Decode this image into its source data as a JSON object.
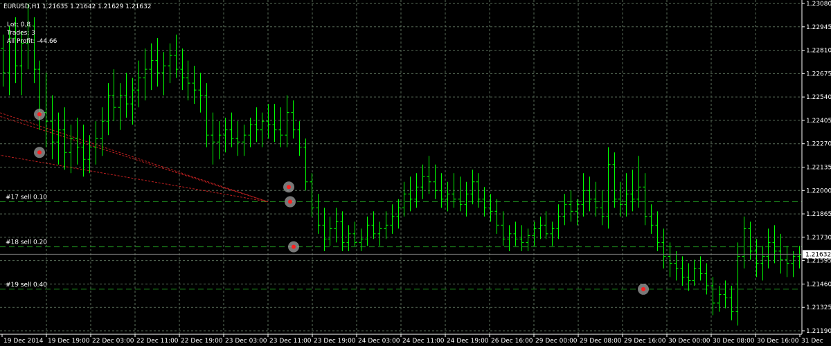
{
  "header": {
    "symbol": "EURUSD,H1",
    "ohlc": "1.21635 1.21642 1.21629 1.21632"
  },
  "info": {
    "lot": "Lot: 0.8",
    "trades": "Trades: 3",
    "profit": "All Profit: -44.66"
  },
  "colors": {
    "background": "#000000",
    "grid": "#5a6e5a",
    "bars": "#00ff00",
    "axis_text": "#ffffff",
    "order_line": "#1e8a1e",
    "trend_line": "#c02020",
    "marker_ring": "#a0a0a0",
    "marker_center": "#ff2020",
    "current_price_box": "#ffffff"
  },
  "chart_data": {
    "type": "ohlc",
    "symbol": "EURUSD",
    "timeframe": "H1",
    "y_ticks": [
      1.2119,
      1.21325,
      1.2146,
      1.21595,
      1.2173,
      1.21865,
      1.22,
      1.22135,
      1.2227,
      1.22405,
      1.2254,
      1.22675,
      1.2281,
      1.22945,
      1.2308
    ],
    "ylim": [
      1.2117,
      1.231
    ],
    "current_price": 1.21632,
    "x_ticks": [
      "19 Dec 2014",
      "19 Dec 19:00",
      "22 Dec 03:00",
      "22 Dec 11:00",
      "22 Dec 19:00",
      "23 Dec 03:00",
      "23 Dec 11:00",
      "23 Dec 19:00",
      "24 Dec 03:00",
      "24 Dec 11:00",
      "24 Dec 19:00",
      "26 Dec 16:00",
      "29 Dec 00:00",
      "29 Dec 08:00",
      "29 Dec 16:00",
      "30 Dec 00:00",
      "30 Dec 08:00",
      "30 Dec 16:00",
      "31 Dec"
    ],
    "order_levels": [
      {
        "label": "#17 sell 0.10",
        "price": 1.21935
      },
      {
        "label": "#18 sell 0.20",
        "price": 1.21675
      },
      {
        "label": "#19 sell 0.40",
        "price": 1.2143
      }
    ],
    "trend_lines": [
      {
        "from": [
          "19 Dec 2014",
          1.2247
        ],
        "to": [
          "23 Dec 11:00",
          1.21935
        ]
      },
      {
        "from": [
          "19 Dec 2014",
          1.2247
        ],
        "to": [
          "23 Dec 11:00",
          1.21935
        ]
      },
      {
        "from": [
          "19 Dec 2014",
          1.2224
        ],
        "to": [
          "23 Dec 11:00",
          1.21935
        ]
      }
    ],
    "trade_markers": [
      {
        "time": "19 Dec 2014",
        "price": 1.2244
      },
      {
        "time": "19 Dec 2014",
        "price": 1.2222
      },
      {
        "time": "23 Dec 11:00",
        "price": 1.2202
      },
      {
        "time": "23 Dec 11:00",
        "price": 1.21935
      },
      {
        "time": "23 Dec 11:00",
        "price": 1.21675
      },
      {
        "time": "29 Dec 16:00",
        "price": 1.2143
      }
    ],
    "bars": [
      [
        1.2282,
        1.229,
        1.226,
        1.2268
      ],
      [
        1.2268,
        1.2295,
        1.2255,
        1.2288
      ],
      [
        1.2288,
        1.23,
        1.2262,
        1.2272
      ],
      [
        1.2272,
        1.2292,
        1.2255,
        1.2285
      ],
      [
        1.2285,
        1.2308,
        1.227,
        1.2295
      ],
      [
        1.2295,
        1.23,
        1.2262,
        1.227
      ],
      [
        1.227,
        1.2275,
        1.2235,
        1.2245
      ],
      [
        1.2245,
        1.2268,
        1.2225,
        1.224
      ],
      [
        1.224,
        1.2255,
        1.2218,
        1.2228
      ],
      [
        1.2228,
        1.2245,
        1.2215,
        1.2235
      ],
      [
        1.2235,
        1.2248,
        1.2212,
        1.2222
      ],
      [
        1.2222,
        1.2238,
        1.221,
        1.223
      ],
      [
        1.223,
        1.2242,
        1.2215,
        1.2225
      ],
      [
        1.2225,
        1.2238,
        1.2208,
        1.2218
      ],
      [
        1.2218,
        1.2232,
        1.221,
        1.2225
      ],
      [
        1.2225,
        1.224,
        1.2215,
        1.223
      ],
      [
        1.223,
        1.2248,
        1.222,
        1.224
      ],
      [
        1.224,
        1.2262,
        1.2232,
        1.2255
      ],
      [
        1.2255,
        1.227,
        1.224,
        1.2248
      ],
      [
        1.2248,
        1.2262,
        1.2235,
        1.2255
      ],
      [
        1.2255,
        1.2268,
        1.2242,
        1.225
      ],
      [
        1.225,
        1.2265,
        1.2238,
        1.2258
      ],
      [
        1.2258,
        1.2275,
        1.2248,
        1.2265
      ],
      [
        1.2265,
        1.2282,
        1.2252,
        1.227
      ],
      [
        1.227,
        1.2285,
        1.2258,
        1.2275
      ],
      [
        1.2275,
        1.2288,
        1.226,
        1.2268
      ],
      [
        1.2268,
        1.228,
        1.2255,
        1.2272
      ],
      [
        1.2272,
        1.2285,
        1.2262,
        1.2278
      ],
      [
        1.2278,
        1.229,
        1.2265,
        1.227
      ],
      [
        1.227,
        1.2282,
        1.2258,
        1.2265
      ],
      [
        1.2265,
        1.2275,
        1.2252,
        1.2262
      ],
      [
        1.2262,
        1.2272,
        1.225,
        1.2258
      ],
      [
        1.2258,
        1.2268,
        1.2245,
        1.2255
      ],
      [
        1.2255,
        1.2262,
        1.2225,
        1.2232
      ],
      [
        1.2232,
        1.2245,
        1.2215,
        1.2228
      ],
      [
        1.2228,
        1.224,
        1.2218,
        1.2232
      ],
      [
        1.2232,
        1.2242,
        1.2222,
        1.2235
      ],
      [
        1.2235,
        1.2245,
        1.2225,
        1.223
      ],
      [
        1.223,
        1.224,
        1.222,
        1.2228
      ],
      [
        1.2228,
        1.2238,
        1.222,
        1.2232
      ],
      [
        1.2232,
        1.2242,
        1.2225,
        1.2238
      ],
      [
        1.2238,
        1.2248,
        1.2228,
        1.2235
      ],
      [
        1.2235,
        1.2245,
        1.2225,
        1.224
      ],
      [
        1.224,
        1.225,
        1.223,
        1.2238
      ],
      [
        1.2238,
        1.225,
        1.2228,
        1.2235
      ],
      [
        1.2235,
        1.2248,
        1.2225,
        1.2232
      ],
      [
        1.2232,
        1.2255,
        1.2225,
        1.2245
      ],
      [
        1.2245,
        1.2252,
        1.223,
        1.2235
      ],
      [
        1.2235,
        1.224,
        1.222,
        1.2225
      ],
      [
        1.2225,
        1.223,
        1.22,
        1.2205
      ],
      [
        1.2205,
        1.221,
        1.2185,
        1.219
      ],
      [
        1.219,
        1.2198,
        1.2175,
        1.218
      ],
      [
        1.218,
        1.219,
        1.2165,
        1.2172
      ],
      [
        1.2172,
        1.2185,
        1.2168,
        1.2178
      ],
      [
        1.2178,
        1.219,
        1.217,
        1.2182
      ],
      [
        1.2182,
        1.2188,
        1.2165,
        1.217
      ],
      [
        1.217,
        1.218,
        1.2165,
        1.2175
      ],
      [
        1.2175,
        1.2182,
        1.2168,
        1.217
      ],
      [
        1.217,
        1.2178,
        1.2165,
        1.2172
      ],
      [
        1.2172,
        1.2185,
        1.2168,
        1.218
      ],
      [
        1.218,
        1.2188,
        1.2172,
        1.2175
      ],
      [
        1.2175,
        1.2182,
        1.2168,
        1.2178
      ],
      [
        1.2178,
        1.2188,
        1.2172,
        1.218
      ],
      [
        1.218,
        1.2192,
        1.2175,
        1.2185
      ],
      [
        1.2185,
        1.2195,
        1.2178,
        1.219
      ],
      [
        1.219,
        1.2205,
        1.2185,
        1.2198
      ],
      [
        1.2198,
        1.2208,
        1.2188,
        1.2195
      ],
      [
        1.2195,
        1.221,
        1.219,
        1.2202
      ],
      [
        1.2202,
        1.2215,
        1.2195,
        1.2208
      ],
      [
        1.2208,
        1.222,
        1.2198,
        1.2205
      ],
      [
        1.2205,
        1.2215,
        1.2195,
        1.22
      ],
      [
        1.22,
        1.221,
        1.219,
        1.2195
      ],
      [
        1.2195,
        1.2205,
        1.2188,
        1.2198
      ],
      [
        1.2198,
        1.221,
        1.219,
        1.2195
      ],
      [
        1.2195,
        1.2208,
        1.2188,
        1.2192
      ],
      [
        1.2192,
        1.2205,
        1.2185,
        1.2198
      ],
      [
        1.2198,
        1.2212,
        1.2192,
        1.2205
      ],
      [
        1.2205,
        1.221,
        1.219,
        1.2195
      ],
      [
        1.2195,
        1.2202,
        1.2185,
        1.219
      ],
      [
        1.219,
        1.2198,
        1.2182,
        1.2188
      ],
      [
        1.2188,
        1.2195,
        1.2175,
        1.218
      ],
      [
        1.218,
        1.2188,
        1.2168,
        1.2172
      ],
      [
        1.2172,
        1.218,
        1.2165,
        1.2175
      ],
      [
        1.2175,
        1.2182,
        1.2168,
        1.2172
      ],
      [
        1.2172,
        1.218,
        1.2165,
        1.217
      ],
      [
        1.217,
        1.2178,
        1.2165,
        1.2174
      ],
      [
        1.2174,
        1.2182,
        1.2168,
        1.2178
      ],
      [
        1.2178,
        1.2185,
        1.2172,
        1.218
      ],
      [
        1.218,
        1.2188,
        1.2172,
        1.2175
      ],
      [
        1.2175,
        1.2182,
        1.2168,
        1.2178
      ],
      [
        1.2178,
        1.2192,
        1.2172,
        1.2185
      ],
      [
        1.2185,
        1.2198,
        1.218,
        1.2192
      ],
      [
        1.2192,
        1.22,
        1.2182,
        1.2188
      ],
      [
        1.2188,
        1.2195,
        1.218,
        1.2192
      ],
      [
        1.2192,
        1.221,
        1.2185,
        1.22
      ],
      [
        1.22,
        1.2208,
        1.2188,
        1.2195
      ],
      [
        1.2195,
        1.2205,
        1.2185,
        1.219
      ],
      [
        1.219,
        1.22,
        1.218,
        1.2185
      ],
      [
        1.2185,
        1.2225,
        1.2178,
        1.2215
      ],
      [
        1.2215,
        1.2222,
        1.219,
        1.2195
      ],
      [
        1.2195,
        1.2205,
        1.2185,
        1.2192
      ],
      [
        1.2192,
        1.221,
        1.2185,
        1.2198
      ],
      [
        1.2198,
        1.2212,
        1.2188,
        1.2195
      ],
      [
        1.2195,
        1.222,
        1.219,
        1.2202
      ],
      [
        1.2202,
        1.221,
        1.218,
        1.2185
      ],
      [
        1.2185,
        1.2192,
        1.2175,
        1.218
      ],
      [
        1.218,
        1.2188,
        1.2165,
        1.217
      ],
      [
        1.217,
        1.2178,
        1.2155,
        1.2162
      ],
      [
        1.2162,
        1.217,
        1.215,
        1.2158
      ],
      [
        1.2158,
        1.2165,
        1.2148,
        1.2155
      ],
      [
        1.2155,
        1.2162,
        1.2145,
        1.215
      ],
      [
        1.215,
        1.2158,
        1.2142,
        1.2148
      ],
      [
        1.2148,
        1.216,
        1.2145,
        1.2155
      ],
      [
        1.2155,
        1.2162,
        1.2148,
        1.2152
      ],
      [
        1.2152,
        1.2158,
        1.214,
        1.2145
      ],
      [
        1.2145,
        1.215,
        1.2128,
        1.2135
      ],
      [
        1.2135,
        1.2145,
        1.213,
        1.214
      ],
      [
        1.214,
        1.2148,
        1.2132,
        1.2138
      ],
      [
        1.2138,
        1.2145,
        1.2125,
        1.213
      ],
      [
        1.213,
        1.217,
        1.2122,
        1.2162
      ],
      [
        1.2162,
        1.2185,
        1.2155,
        1.2178
      ],
      [
        1.2178,
        1.2182,
        1.216,
        1.2165
      ],
      [
        1.2165,
        1.2172,
        1.215,
        1.2158
      ],
      [
        1.2158,
        1.2168,
        1.2148,
        1.2162
      ],
      [
        1.2162,
        1.2178,
        1.2155,
        1.217
      ],
      [
        1.217,
        1.218,
        1.2158,
        1.2165
      ],
      [
        1.2165,
        1.2175,
        1.2152,
        1.216
      ],
      [
        1.216,
        1.2168,
        1.215,
        1.2158
      ],
      [
        1.2158,
        1.2165,
        1.215,
        1.2162
      ],
      [
        1.2162,
        1.2168,
        1.2155,
        1.2163
      ]
    ]
  }
}
